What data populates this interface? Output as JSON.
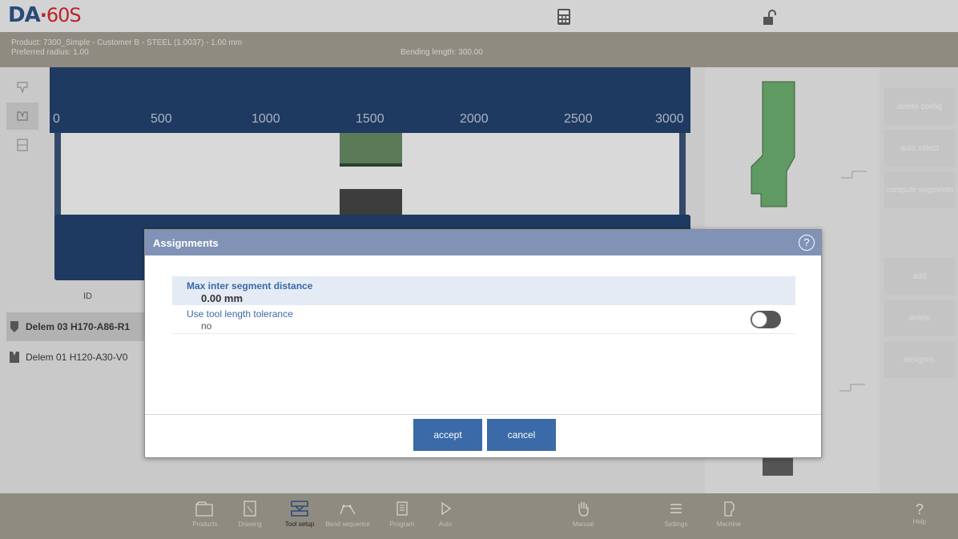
{
  "app": {
    "logo_brand": "DA",
    "logo_dot": "·",
    "logo_model": "60S"
  },
  "info": {
    "product": "Product: 7300_Simple - Customer B - STEEL (1.0037) - 1.00 mm",
    "radius": "Preferred radius: 1.00",
    "bending_length": "Bending length: 300.00"
  },
  "ruler": [
    "0",
    "500",
    "1000",
    "1500",
    "2000",
    "2500",
    "3000"
  ],
  "list": {
    "header": "ID",
    "rows": [
      "Delem 03 H170-A86-R1",
      "Delem 01 H120-A30-V0"
    ]
  },
  "right_buttons": [
    "delete config",
    "auto select",
    "compute segments",
    "add",
    "delete",
    "assignm."
  ],
  "dialog": {
    "title": "Assignments",
    "help": "?",
    "field1_label": "Max inter segment distance",
    "field1_value": "0.00 mm",
    "field2_label": "Use tool length tolerance",
    "field2_value": "no",
    "toggle_on": false,
    "accept": "accept",
    "cancel": "cancel"
  },
  "nav": {
    "items": [
      "Products",
      "Drawing",
      "Tool setup",
      "Bend sequence",
      "Program",
      "Auto",
      "Manual",
      "Settings",
      "Machine"
    ],
    "help_symbol": "?",
    "help_label": "Help",
    "active": "Tool setup"
  },
  "colors": {
    "beam": "#1f3a60",
    "dialog_header": "#8093b7",
    "button": "#3a6aa8",
    "logo_red": "#b8252b"
  }
}
